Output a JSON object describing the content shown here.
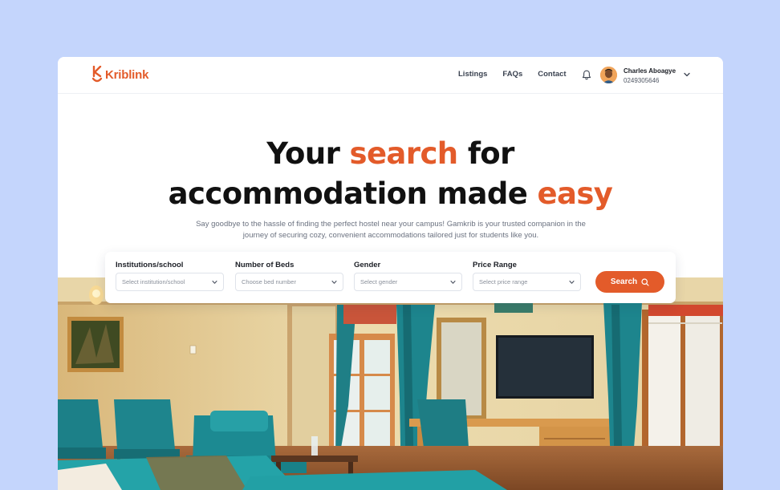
{
  "brand": {
    "name": "Kriblink",
    "color": "#e35b2a"
  },
  "nav": {
    "items": [
      "Listings",
      "FAQs",
      "Contact"
    ]
  },
  "user": {
    "name": "Charles Aboagye",
    "phone": "0249305646"
  },
  "hero": {
    "title_part1": "Your ",
    "title_accent1": "search",
    "title_part2": " for",
    "title_part3": "accommodation made ",
    "title_accent2": "easy",
    "subtitle": "Say goodbye to the hassle of finding the perfect hostel near your campus! Gamkrib is your trusted companion in the journey of securing cozy, convenient accommodations tailored just for students like you."
  },
  "search": {
    "fields": [
      {
        "label": "Institutions/school",
        "placeholder": "Select institution/school"
      },
      {
        "label": "Number of Beds",
        "placeholder": "Choose bed number"
      },
      {
        "label": "Gender",
        "placeholder": "Select gender"
      },
      {
        "label": "Price Range",
        "placeholder": "Select price range"
      }
    ],
    "button_label": "Search"
  },
  "icons": [
    "bell-icon",
    "chevron-down-icon",
    "search-icon"
  ]
}
